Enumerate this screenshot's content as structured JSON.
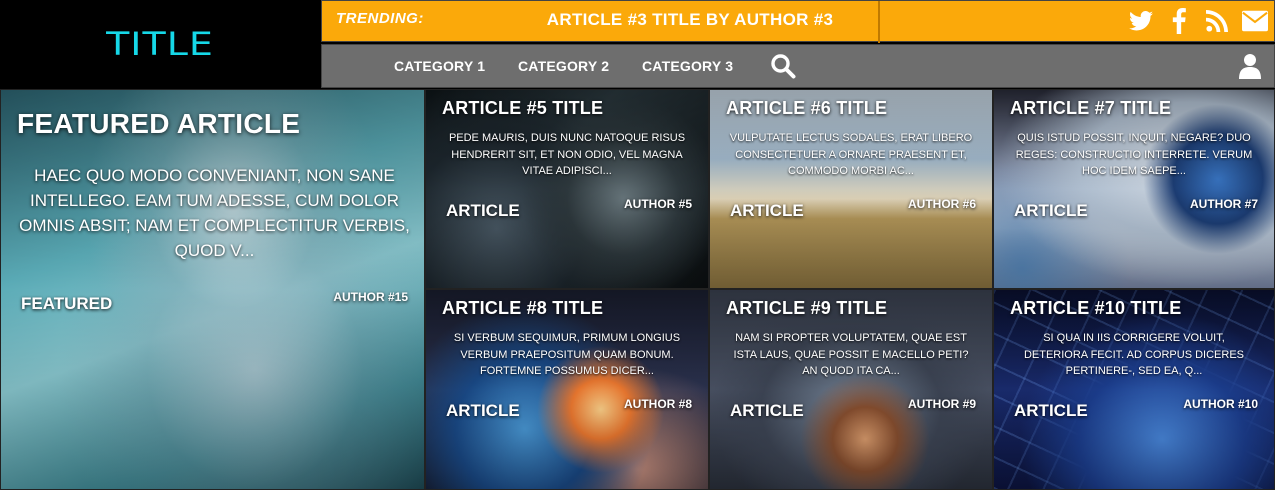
{
  "header": {
    "logo": "TITLE",
    "trending_label": "TRENDING:",
    "trending_title": "ARTICLE #3 TITLE BY AUTHOR #3",
    "social": [
      {
        "icon": "twitter-icon"
      },
      {
        "icon": "facebook-icon"
      },
      {
        "icon": "rss-icon"
      },
      {
        "icon": "email-icon"
      }
    ],
    "nav": [
      "CATEGORY 1",
      "CATEGORY 2",
      "CATEGORY 3"
    ]
  },
  "featured": {
    "title": "FEATURED ARTICLE",
    "excerpt": "HAEC QUO MODO CONVENIANT, NON SANE INTELLEGO. EAM TUM ADESSE, CUM DOLOR OMNIS ABSIT; NAM ET COMPLECTITUR VERBIS, QUOD V...",
    "category": "FEATURED",
    "author": "AUTHOR #15"
  },
  "articles": [
    {
      "title": "ARTICLE #5 TITLE",
      "excerpt": "PEDE MAURIS, DUIS NUNC NATOQUE RISUS HENDRERIT SIT, ET NON ODIO, VEL MAGNA VITAE ADIPISCI...",
      "category": "ARTICLE",
      "author": "AUTHOR #5"
    },
    {
      "title": "ARTICLE #6 TITLE",
      "excerpt": "VULPUTATE LECTUS SODALES, ERAT LIBERO CONSECTETUER A ORNARE PRAESENT ET, COMMODO MORBI AC...",
      "category": "ARTICLE",
      "author": "AUTHOR #6"
    },
    {
      "title": "ARTICLE #7 TITLE",
      "excerpt": "QUIS ISTUD POSSIT, INQUIT, NEGARE? DUO REGES: CONSTRUCTIO INTERRETE. VERUM HOC IDEM SAEPE...",
      "category": "ARTICLE",
      "author": "AUTHOR #7"
    },
    {
      "title": "ARTICLE #8 TITLE",
      "excerpt": "SI VERBUM SEQUIMUR, PRIMUM LONGIUS VERBUM PRAEPOSITUM QUAM BONUM. FORTEMNE POSSUMUS DICER...",
      "category": "ARTICLE",
      "author": "AUTHOR #8"
    },
    {
      "title": "ARTICLE #9 TITLE",
      "excerpt": "NAM SI PROPTER VOLUPTATEM, QUAE EST ISTA LAUS, QUAE POSSIT E MACELLO PETI? AN QUOD ITA CA...",
      "category": "ARTICLE",
      "author": "AUTHOR #9"
    },
    {
      "title": "ARTICLE #10 TITLE",
      "excerpt": "SI QUA IN IIS CORRIGERE VOLUIT, DETERIORA FECIT. AD CORPUS DICERES PERTINERE-, SED EA, Q...",
      "category": "ARTICLE",
      "author": "AUTHOR #10"
    }
  ],
  "colors": {
    "logo": "#16d8e8",
    "trending_bar": "#fba90a",
    "nav_bar": "#6e6e6e"
  }
}
